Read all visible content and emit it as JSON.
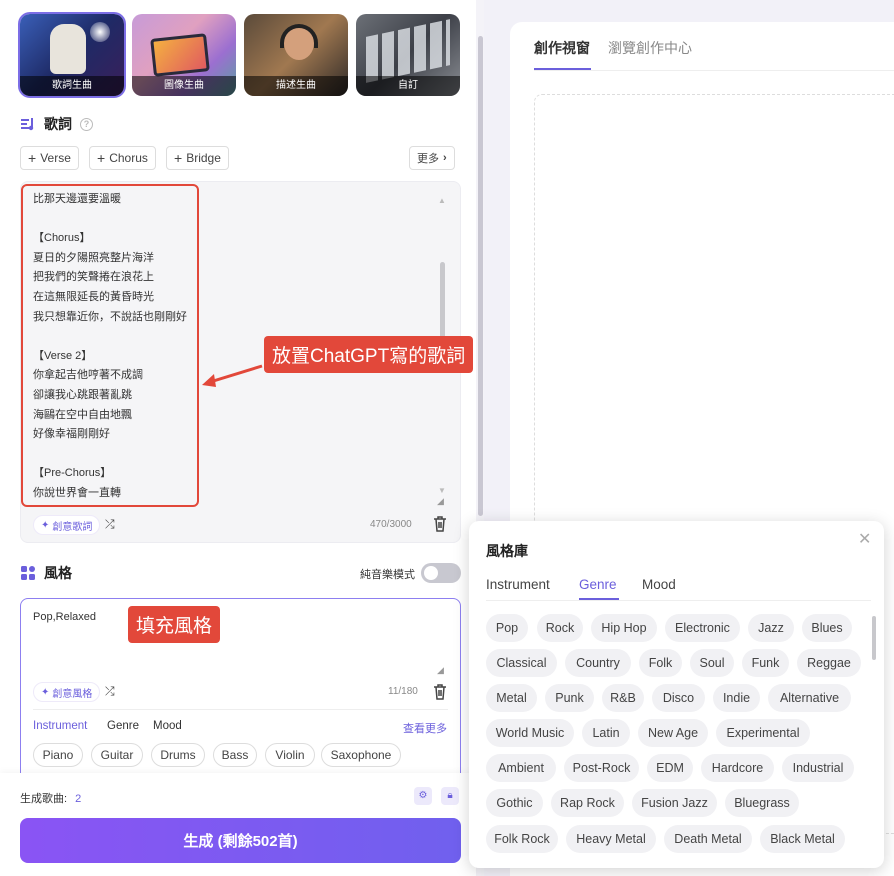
{
  "modes": [
    {
      "label": "歌詞生曲",
      "selected": true
    },
    {
      "label": "圖像生曲",
      "selected": false
    },
    {
      "label": "描述生曲",
      "selected": false
    },
    {
      "label": "自訂",
      "selected": false
    }
  ],
  "lyrics": {
    "title": "歌詞",
    "add_verse": "Verse",
    "add_chorus": "Chorus",
    "add_bridge": "Bridge",
    "more": "更多",
    "text": "比那天邊還要溫暖\n\n【Chorus】\n夏日的夕陽照亮整片海洋\n把我們的笑聲捲在浪花上\n在這無限延長的黃昏時光\n我只想靠近你，不說話也剛剛好\n\n【Verse 2】\n你拿起吉他哼著不成調\n卻讓我心跳跟著亂跳\n海鷗在空中自由地飄\n好像幸福剛剛好\n\n【Pre-Chorus】\n你說世界會一直轉",
    "ai_button": "創意歌詞",
    "counter": "470/3000"
  },
  "annotations": {
    "lyrics_callout": "放置ChatGPT寫的歌詞",
    "style_callout": "填充風格"
  },
  "style": {
    "title": "風格",
    "instrumental_label": "純音樂模式",
    "value": "Pop,Relaxed",
    "ai_button": "創意風格",
    "counter": "11/180",
    "tabs": [
      "Instrument",
      "Genre",
      "Mood"
    ],
    "see_more": "查看更多",
    "instrument_tags": [
      "Piano",
      "Guitar",
      "Drums",
      "Bass",
      "Violin",
      "Saxophone"
    ]
  },
  "footer": {
    "gen_label": "生成歌曲:",
    "gen_count": "2",
    "generate_button": "生成 (剩餘502首)"
  },
  "right": {
    "tab_active": "創作視窗",
    "tab_inactive": "瀏覽創作中心"
  },
  "library": {
    "title": "風格庫",
    "tabs": [
      "Instrument",
      "Genre",
      "Mood"
    ],
    "active_tab": "Genre",
    "genres": [
      [
        "Pop",
        "Rock",
        "Hip Hop",
        "Electronic",
        "Jazz",
        "Blues"
      ],
      [
        "Classical",
        "Country",
        "Folk",
        "Soul",
        "Funk",
        "Reggae"
      ],
      [
        "Metal",
        "Punk",
        "R&B",
        "Disco",
        "Indie",
        "Alternative"
      ],
      [
        "World Music",
        "Latin",
        "New Age",
        "Experimental"
      ],
      [
        "Ambient",
        "Post-Rock",
        "EDM",
        "Hardcore",
        "Industrial"
      ],
      [
        "Gothic",
        "Rap Rock",
        "Fusion Jazz",
        "Bluegrass"
      ],
      [
        "Folk Rock",
        "Heavy Metal",
        "Death Metal",
        "Black Metal"
      ]
    ]
  },
  "colors": {
    "accent": "#6b5fdc",
    "annotation_red": "#e2483a"
  }
}
